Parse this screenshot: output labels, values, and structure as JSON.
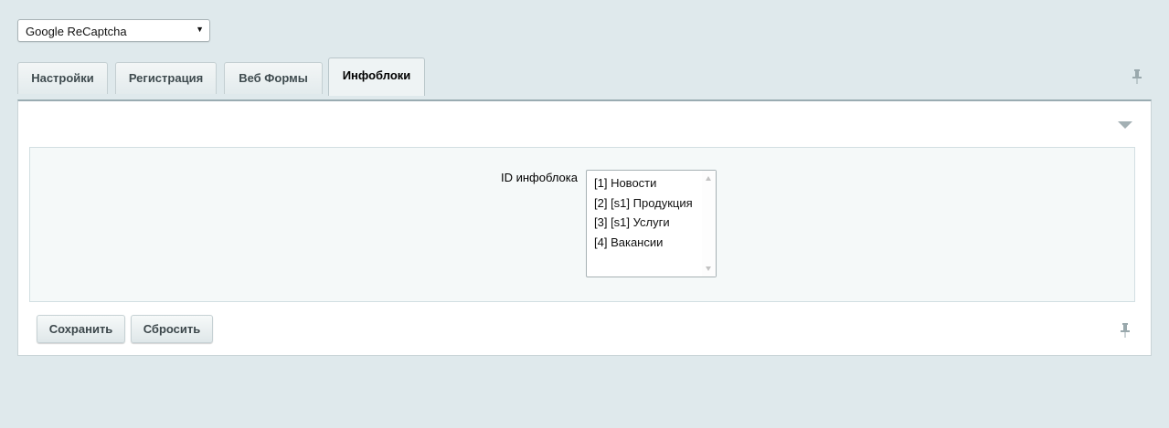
{
  "site_select": {
    "value": "Google ReCaptcha",
    "arrow": "▼"
  },
  "tabs": [
    {
      "label": "Настройки",
      "active": false
    },
    {
      "label": "Регистрация",
      "active": false
    },
    {
      "label": "Веб Формы",
      "active": false
    },
    {
      "label": "Инфоблоки",
      "active": true
    }
  ],
  "form": {
    "iblock_label": "ID инфоблока",
    "iblock_options": [
      "[1] Новости",
      "[2] [s1] Продукция",
      "[3] [s1] Услуги",
      "[4] Вакансии"
    ]
  },
  "buttons": {
    "save": "Сохранить",
    "reset": "Сбросить"
  },
  "icons": {
    "tabs_pin": "pin-icon",
    "footer_pin": "pin-icon",
    "collapse": "collapse-arrow-icon"
  },
  "colors": {
    "background": "#dfe9ec",
    "panel": "#ffffff",
    "inner": "#f5f9f9"
  }
}
